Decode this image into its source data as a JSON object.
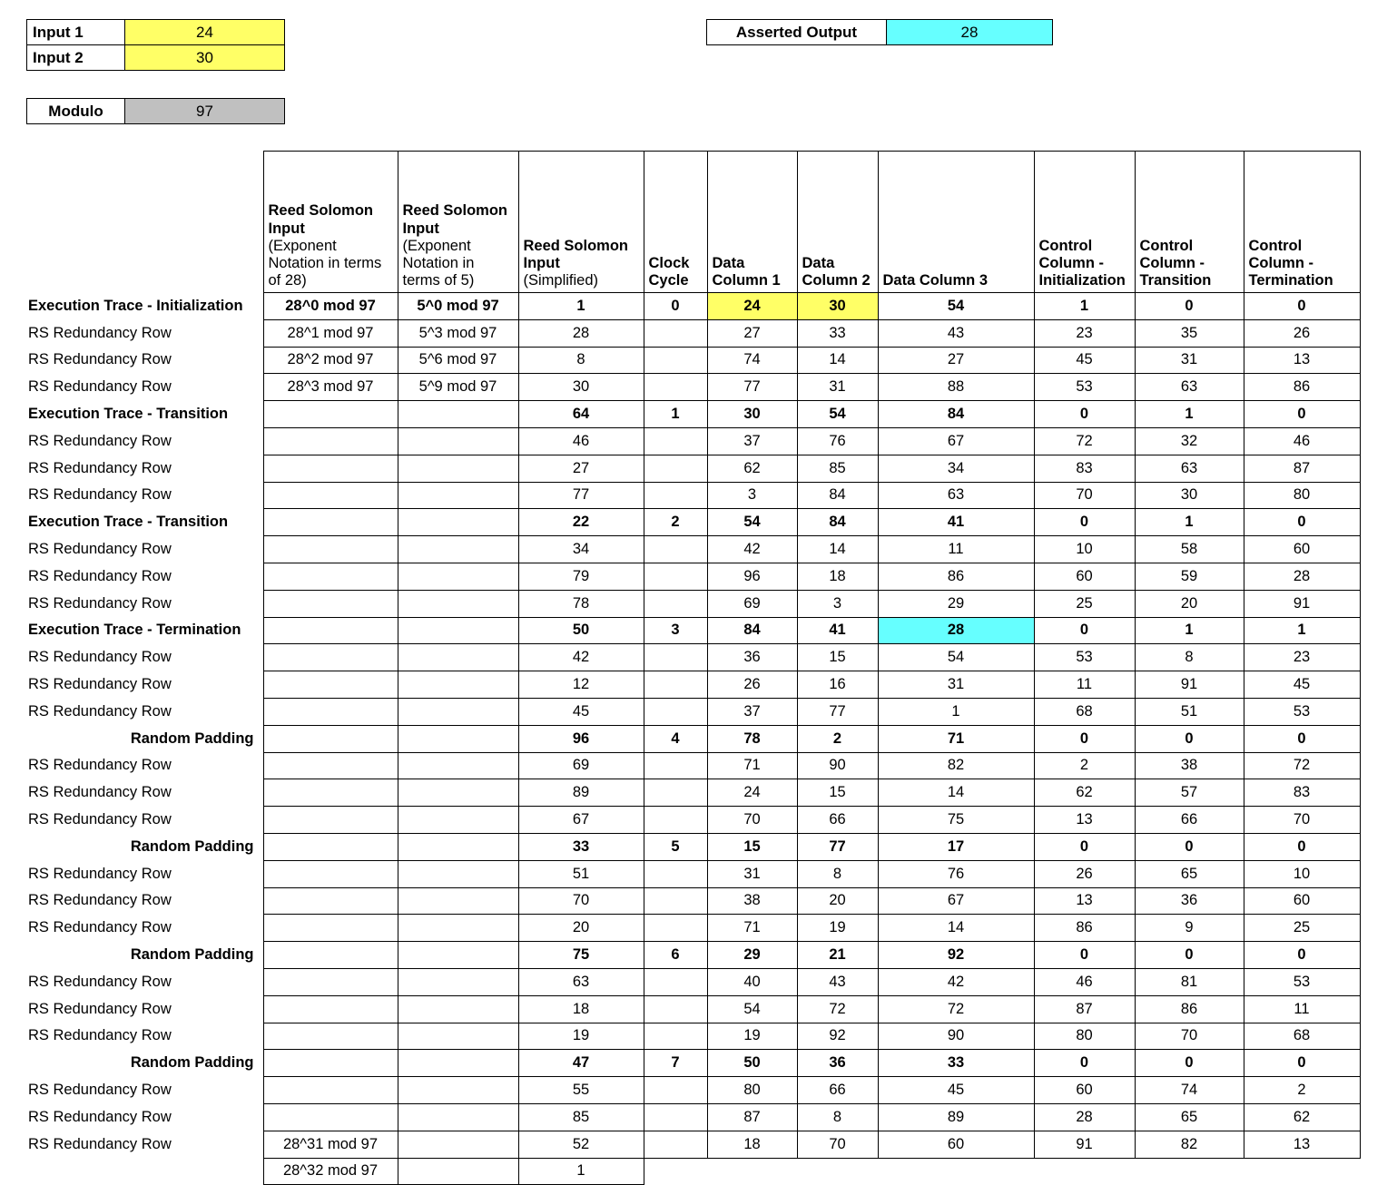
{
  "inputs": {
    "rows": [
      {
        "label": "Input 1",
        "value": "24"
      },
      {
        "label": "Input 2",
        "value": "30"
      }
    ]
  },
  "modulo": {
    "label": "Modulo",
    "value": "97"
  },
  "asserted_output": {
    "label": "Asserted Output",
    "value": "28"
  },
  "colors": {
    "highlight_input": "#ffff66",
    "highlight_output": "#66ffff",
    "modulo_fill": "#c0c0c0",
    "border": "#000000"
  },
  "table": {
    "headers": {
      "row_label": "",
      "rs_input_28_main": "Reed Solomon Input",
      "rs_input_28_sub": "(Exponent Notation in terms of 28)",
      "rs_input_5_main": "Reed Solomon Input",
      "rs_input_5_sub": "(Exponent Notation in terms of 5)",
      "rs_simplified_main": "Reed Solomon Input",
      "rs_simplified_sub": "(Simplified)",
      "clock_cycle": "Clock Cycle",
      "data_column_1": "Data Column 1",
      "data_column_2": "Data Column 2",
      "data_column_3": "Data Column 3",
      "control_init": "Control Column - Initialization",
      "control_transition": "Control Column - Transition",
      "control_termination": "Control Column - Termination"
    },
    "rows": [
      {
        "label": "Execution Trace - Initialization",
        "label_style": "bold-clip",
        "bold": true,
        "rs28": "28^0 mod 97",
        "rs5": "5^0 mod 97",
        "simplified": "1",
        "clock": "0",
        "d1": "24",
        "d2": "30",
        "d3": "54",
        "ci": "1",
        "ct": "0",
        "cterm": "0",
        "hl_d1": "yellow",
        "hl_d2": "yellow"
      },
      {
        "label": "RS Redundancy Row",
        "label_style": "plain",
        "bold": false,
        "rs28": "28^1 mod 97",
        "rs5": "5^3 mod 97",
        "simplified": "28",
        "clock": "",
        "d1": "27",
        "d2": "33",
        "d3": "43",
        "ci": "23",
        "ct": "35",
        "cterm": "26"
      },
      {
        "label": "RS Redundancy Row",
        "label_style": "plain",
        "bold": false,
        "rs28": "28^2 mod 97",
        "rs5": "5^6 mod 97",
        "simplified": "8",
        "clock": "",
        "d1": "74",
        "d2": "14",
        "d3": "27",
        "ci": "45",
        "ct": "31",
        "cterm": "13"
      },
      {
        "label": "RS Redundancy Row",
        "label_style": "plain",
        "bold": false,
        "rs28": "28^3 mod 97",
        "rs5": "5^9 mod 97",
        "simplified": "30",
        "clock": "",
        "d1": "77",
        "d2": "31",
        "d3": "88",
        "ci": "53",
        "ct": "63",
        "cterm": "86"
      },
      {
        "label": "Execution Trace - Transition",
        "label_style": "bold",
        "bold": true,
        "rs28": "",
        "rs5": "",
        "simplified": "64",
        "clock": "1",
        "d1": "30",
        "d2": "54",
        "d3": "84",
        "ci": "0",
        "ct": "1",
        "cterm": "0"
      },
      {
        "label": "RS Redundancy Row",
        "label_style": "plain",
        "bold": false,
        "rs28": "",
        "rs5": "",
        "simplified": "46",
        "clock": "",
        "d1": "37",
        "d2": "76",
        "d3": "67",
        "ci": "72",
        "ct": "32",
        "cterm": "46"
      },
      {
        "label": "RS Redundancy Row",
        "label_style": "plain",
        "bold": false,
        "rs28": "",
        "rs5": "",
        "simplified": "27",
        "clock": "",
        "d1": "62",
        "d2": "85",
        "d3": "34",
        "ci": "83",
        "ct": "63",
        "cterm": "87"
      },
      {
        "label": "RS Redundancy Row",
        "label_style": "plain",
        "bold": false,
        "rs28": "",
        "rs5": "",
        "simplified": "77",
        "clock": "",
        "d1": "3",
        "d2": "84",
        "d3": "63",
        "ci": "70",
        "ct": "30",
        "cterm": "80"
      },
      {
        "label": "Execution Trace - Transition",
        "label_style": "bold",
        "bold": true,
        "rs28": "",
        "rs5": "",
        "simplified": "22",
        "clock": "2",
        "d1": "54",
        "d2": "84",
        "d3": "41",
        "ci": "0",
        "ct": "1",
        "cterm": "0"
      },
      {
        "label": "RS Redundancy Row",
        "label_style": "plain",
        "bold": false,
        "rs28": "",
        "rs5": "",
        "simplified": "34",
        "clock": "",
        "d1": "42",
        "d2": "14",
        "d3": "11",
        "ci": "10",
        "ct": "58",
        "cterm": "60"
      },
      {
        "label": "RS Redundancy Row",
        "label_style": "plain",
        "bold": false,
        "rs28": "",
        "rs5": "",
        "simplified": "79",
        "clock": "",
        "d1": "96",
        "d2": "18",
        "d3": "86",
        "ci": "60",
        "ct": "59",
        "cterm": "28"
      },
      {
        "label": "RS Redundancy Row",
        "label_style": "plain",
        "bold": false,
        "rs28": "",
        "rs5": "",
        "simplified": "78",
        "clock": "",
        "d1": "69",
        "d2": "3",
        "d3": "29",
        "ci": "25",
        "ct": "20",
        "cterm": "91"
      },
      {
        "label": "Execution Trace - Termination",
        "label_style": "bold",
        "bold": true,
        "rs28": "",
        "rs5": "",
        "simplified": "50",
        "clock": "3",
        "d1": "84",
        "d2": "41",
        "d3": "28",
        "ci": "0",
        "ct": "1",
        "cterm": "1",
        "hl_d3": "cyan"
      },
      {
        "label": "RS Redundancy Row",
        "label_style": "plain",
        "bold": false,
        "rs28": "",
        "rs5": "",
        "simplified": "42",
        "clock": "",
        "d1": "36",
        "d2": "15",
        "d3": "54",
        "ci": "53",
        "ct": "8",
        "cterm": "23"
      },
      {
        "label": "RS Redundancy Row",
        "label_style": "plain",
        "bold": false,
        "rs28": "",
        "rs5": "",
        "simplified": "12",
        "clock": "",
        "d1": "26",
        "d2": "16",
        "d3": "31",
        "ci": "11",
        "ct": "91",
        "cterm": "45"
      },
      {
        "label": "RS Redundancy Row",
        "label_style": "plain",
        "bold": false,
        "rs28": "",
        "rs5": "",
        "simplified": "45",
        "clock": "",
        "d1": "37",
        "d2": "77",
        "d3": "1",
        "ci": "68",
        "ct": "51",
        "cterm": "53"
      },
      {
        "label": "Random Padding",
        "label_style": "bold-right",
        "bold": true,
        "rs28": "",
        "rs5": "",
        "simplified": "96",
        "clock": "4",
        "d1": "78",
        "d2": "2",
        "d3": "71",
        "ci": "0",
        "ct": "0",
        "cterm": "0"
      },
      {
        "label": "RS Redundancy Row",
        "label_style": "plain",
        "bold": false,
        "rs28": "",
        "rs5": "",
        "simplified": "69",
        "clock": "",
        "d1": "71",
        "d2": "90",
        "d3": "82",
        "ci": "2",
        "ct": "38",
        "cterm": "72"
      },
      {
        "label": "RS Redundancy Row",
        "label_style": "plain",
        "bold": false,
        "rs28": "",
        "rs5": "",
        "simplified": "89",
        "clock": "",
        "d1": "24",
        "d2": "15",
        "d3": "14",
        "ci": "62",
        "ct": "57",
        "cterm": "83"
      },
      {
        "label": "RS Redundancy Row",
        "label_style": "plain",
        "bold": false,
        "rs28": "",
        "rs5": "",
        "simplified": "67",
        "clock": "",
        "d1": "70",
        "d2": "66",
        "d3": "75",
        "ci": "13",
        "ct": "66",
        "cterm": "70"
      },
      {
        "label": "Random Padding",
        "label_style": "bold-right",
        "bold": true,
        "rs28": "",
        "rs5": "",
        "simplified": "33",
        "clock": "5",
        "d1": "15",
        "d2": "77",
        "d3": "17",
        "ci": "0",
        "ct": "0",
        "cterm": "0"
      },
      {
        "label": "RS Redundancy Row",
        "label_style": "plain",
        "bold": false,
        "rs28": "",
        "rs5": "",
        "simplified": "51",
        "clock": "",
        "d1": "31",
        "d2": "8",
        "d3": "76",
        "ci": "26",
        "ct": "65",
        "cterm": "10"
      },
      {
        "label": "RS Redundancy Row",
        "label_style": "plain",
        "bold": false,
        "rs28": "",
        "rs5": "",
        "simplified": "70",
        "clock": "",
        "d1": "38",
        "d2": "20",
        "d3": "67",
        "ci": "13",
        "ct": "36",
        "cterm": "60"
      },
      {
        "label": "RS Redundancy Row",
        "label_style": "plain",
        "bold": false,
        "rs28": "",
        "rs5": "",
        "simplified": "20",
        "clock": "",
        "d1": "71",
        "d2": "19",
        "d3": "14",
        "ci": "86",
        "ct": "9",
        "cterm": "25"
      },
      {
        "label": "Random Padding",
        "label_style": "bold-right",
        "bold": true,
        "rs28": "",
        "rs5": "",
        "simplified": "75",
        "clock": "6",
        "d1": "29",
        "d2": "21",
        "d3": "92",
        "ci": "0",
        "ct": "0",
        "cterm": "0"
      },
      {
        "label": "RS Redundancy Row",
        "label_style": "plain",
        "bold": false,
        "rs28": "",
        "rs5": "",
        "simplified": "63",
        "clock": "",
        "d1": "40",
        "d2": "43",
        "d3": "42",
        "ci": "46",
        "ct": "81",
        "cterm": "53"
      },
      {
        "label": "RS Redundancy Row",
        "label_style": "plain",
        "bold": false,
        "rs28": "",
        "rs5": "",
        "simplified": "18",
        "clock": "",
        "d1": "54",
        "d2": "72",
        "d3": "72",
        "ci": "87",
        "ct": "86",
        "cterm": "11"
      },
      {
        "label": "RS Redundancy Row",
        "label_style": "plain",
        "bold": false,
        "rs28": "",
        "rs5": "",
        "simplified": "19",
        "clock": "",
        "d1": "19",
        "d2": "92",
        "d3": "90",
        "ci": "80",
        "ct": "70",
        "cterm": "68"
      },
      {
        "label": "Random Padding",
        "label_style": "bold-right",
        "bold": true,
        "rs28": "",
        "rs5": "",
        "simplified": "47",
        "clock": "7",
        "d1": "50",
        "d2": "36",
        "d3": "33",
        "ci": "0",
        "ct": "0",
        "cterm": "0"
      },
      {
        "label": "RS Redundancy Row",
        "label_style": "plain",
        "bold": false,
        "rs28": "",
        "rs5": "",
        "simplified": "55",
        "clock": "",
        "d1": "80",
        "d2": "66",
        "d3": "45",
        "ci": "60",
        "ct": "74",
        "cterm": "2"
      },
      {
        "label": "RS Redundancy Row",
        "label_style": "plain",
        "bold": false,
        "rs28": "",
        "rs5": "",
        "simplified": "85",
        "clock": "",
        "d1": "87",
        "d2": "8",
        "d3": "89",
        "ci": "28",
        "ct": "65",
        "cterm": "62"
      },
      {
        "label": "RS Redundancy Row",
        "label_style": "plain",
        "bold": false,
        "rs28": "28^31 mod 97",
        "rs5": "",
        "simplified": "52",
        "clock": "",
        "d1": "18",
        "d2": "70",
        "d3": "60",
        "ci": "91",
        "ct": "82",
        "cterm": "13"
      },
      {
        "label": "",
        "label_style": "plain",
        "bold": false,
        "rs28": "28^32 mod 97",
        "rs5": "",
        "simplified": "1",
        "clock": "",
        "d1": "",
        "d2": "",
        "d3": "",
        "ci": "",
        "ct": "",
        "cterm": "",
        "last_row": true
      }
    ]
  }
}
